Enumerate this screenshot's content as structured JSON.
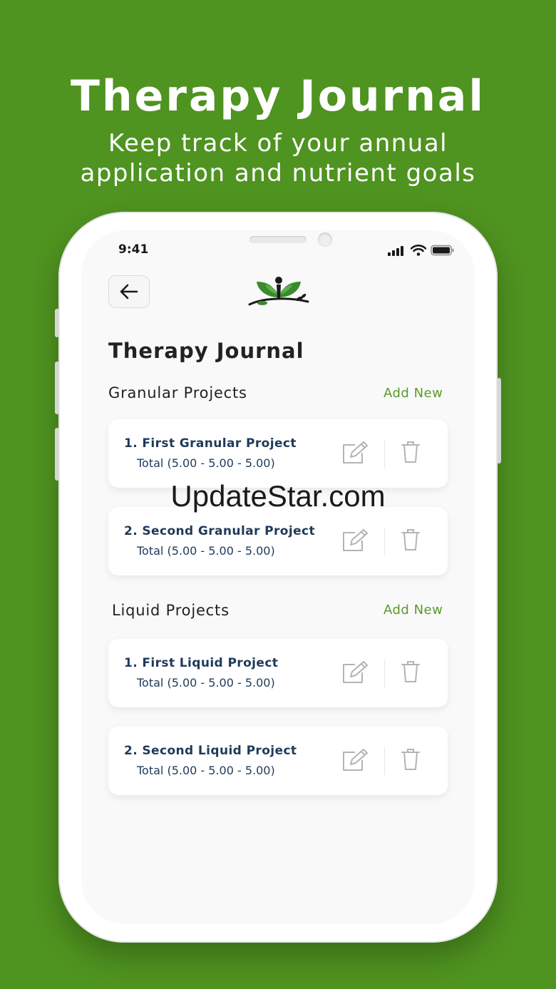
{
  "hero": {
    "title": "Therapy Journal",
    "subtitle_line1": "Keep track of your annual",
    "subtitle_line2": "application and nutrient goals"
  },
  "status_bar": {
    "time": "9:41",
    "icons": [
      "signal-icon",
      "wifi-icon",
      "battery-icon"
    ]
  },
  "header": {
    "back_icon": "arrow-left-icon",
    "logo": "leaf-person-logo"
  },
  "page": {
    "title": "Therapy Journal"
  },
  "sections": [
    {
      "title": "Granular Projects",
      "add_label": "Add New",
      "items": [
        {
          "name": "1. First Granular Project",
          "total": "Total (5.00 - 5.00 - 5.00)"
        },
        {
          "name": "2. Second Granular Project",
          "total": "Total (5.00 - 5.00 - 5.00)"
        }
      ]
    },
    {
      "title": "Liquid Projects",
      "add_label": "Add New",
      "items": [
        {
          "name": "1. First Liquid Project",
          "total": "Total (5.00 - 5.00 - 5.00)"
        },
        {
          "name": "2. Second Liquid Project",
          "total": "Total (5.00 - 5.00 - 5.00)"
        }
      ]
    }
  ],
  "watermark": "UpdateStar.com",
  "colors": {
    "background": "#4f9320",
    "accent": "#5a9a2a",
    "item_text": "#1e3a5a"
  }
}
